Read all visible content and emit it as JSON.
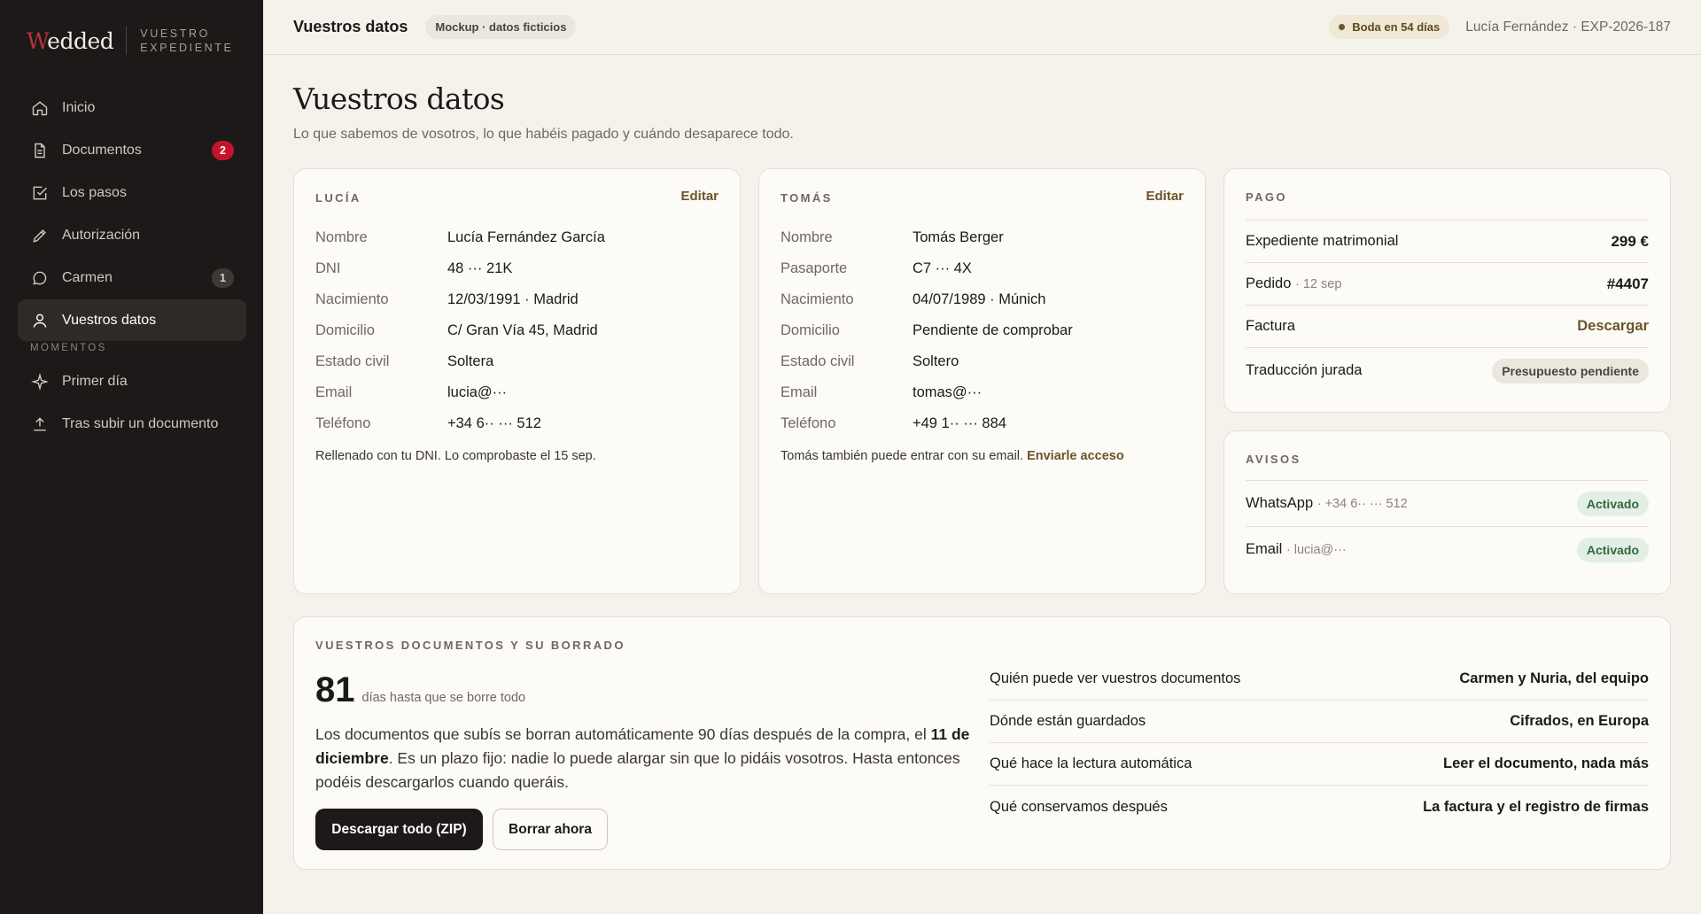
{
  "brand": {
    "logo_initial": "W",
    "logo_rest": "edded",
    "subtitle_line1": "VUESTRO",
    "subtitle_line2": "EXPEDIENTE"
  },
  "sidebar": {
    "items": [
      {
        "label": "Inicio",
        "icon": "home-icon"
      },
      {
        "label": "Documentos",
        "icon": "document-icon",
        "badge": "2"
      },
      {
        "label": "Los pasos",
        "icon": "checkbox-icon"
      },
      {
        "label": "Autorización",
        "icon": "pen-icon"
      },
      {
        "label": "Carmen",
        "icon": "chat-icon",
        "badge": "1"
      },
      {
        "label": "Vuestros datos",
        "icon": "user-icon",
        "active": true
      }
    ],
    "section_label": "MOMENTOS",
    "moments": [
      {
        "label": "Primer día",
        "icon": "sparkle-icon"
      },
      {
        "label": "Tras subir un documento",
        "icon": "upload-icon"
      }
    ]
  },
  "header": {
    "title": "Vuestros datos",
    "mockup_chip": "Mockup · datos ficticios",
    "wedding_chip": "Boda en 54 días",
    "user": "Lucía Fernández · EXP-2026-187"
  },
  "page": {
    "title": "Vuestros datos",
    "subtitle": "Lo que sabemos de vosotros, lo que habéis pagado y cuándo desaparece todo."
  },
  "lucia": {
    "label": "LUCÍA",
    "edit": "Editar",
    "rows": [
      {
        "k": "Nombre",
        "v": "Lucía Fernández García"
      },
      {
        "k": "DNI",
        "v": "48 ··· 21K"
      },
      {
        "k": "Nacimiento",
        "v": "12/03/1991 · Madrid"
      },
      {
        "k": "Domicilio",
        "v": "C/ Gran Vía 45, Madrid"
      },
      {
        "k": "Estado civil",
        "v": "Soltera"
      },
      {
        "k": "Email",
        "v": "lucia@···"
      },
      {
        "k": "Teléfono",
        "v": "+34 6·· ··· 512"
      }
    ],
    "note": "Rellenado con tu DNI. Lo comprobaste el 15 sep."
  },
  "tomas": {
    "label": "TOMÁS",
    "edit": "Editar",
    "rows": [
      {
        "k": "Nombre",
        "v": "Tomás Berger"
      },
      {
        "k": "Pasaporte",
        "v": "C7 ··· 4X"
      },
      {
        "k": "Nacimiento",
        "v": "04/07/1989 · Múnich"
      },
      {
        "k": "Domicilio",
        "v": "Pendiente de comprobar"
      },
      {
        "k": "Estado civil",
        "v": "Soltero"
      },
      {
        "k": "Email",
        "v": "tomas@···"
      },
      {
        "k": "Teléfono",
        "v": "+49 1·· ··· 884"
      }
    ],
    "note": "Tomás también puede entrar con su email.",
    "note_link": "Enviarle acceso"
  },
  "payment": {
    "label": "PAGO",
    "expediente_label": "Expediente matrimonial",
    "expediente_value": "299 €",
    "pedido_label": "Pedido",
    "pedido_date": "· 12 sep",
    "pedido_value": "#4407",
    "factura_label": "Factura",
    "factura_action": "Descargar",
    "traduccion_label": "Traducción jurada",
    "traduccion_status": "Presupuesto pendiente"
  },
  "notices": {
    "label": "AVISOS",
    "whatsapp_label": "WhatsApp",
    "whatsapp_detail": "· +34 6·· ··· 512",
    "whatsapp_status": "Activado",
    "email_label": "Email",
    "email_detail": "· lucia@···",
    "email_status": "Activado"
  },
  "documents": {
    "label": "VUESTROS DOCUMENTOS Y SU BORRADO",
    "days": "81",
    "days_label": "días hasta que se borre todo",
    "text_1": "Los documentos que subís se borran automáticamente 90 días después de la compra, el ",
    "text_date": "11 de diciembre",
    "text_2": ". Es un plazo fijo: nadie lo puede alargar sin que lo pidáis vosotros. Hasta entonces podéis descargarlos cuando queráis.",
    "download_button": "Descargar todo (ZIP)",
    "delete_button": "Borrar ahora",
    "info": [
      {
        "k": "Quién puede ver vuestros documentos",
        "v": "Carmen y Nuria, del equipo"
      },
      {
        "k": "Dónde están guardados",
        "v": "Cifrados, en Europa"
      },
      {
        "k": "Qué hace la lectura automática",
        "v": "Leer el documento, nada más"
      },
      {
        "k": "Qué conservamos después",
        "v": "La factura y el registro de firmas"
      }
    ]
  }
}
